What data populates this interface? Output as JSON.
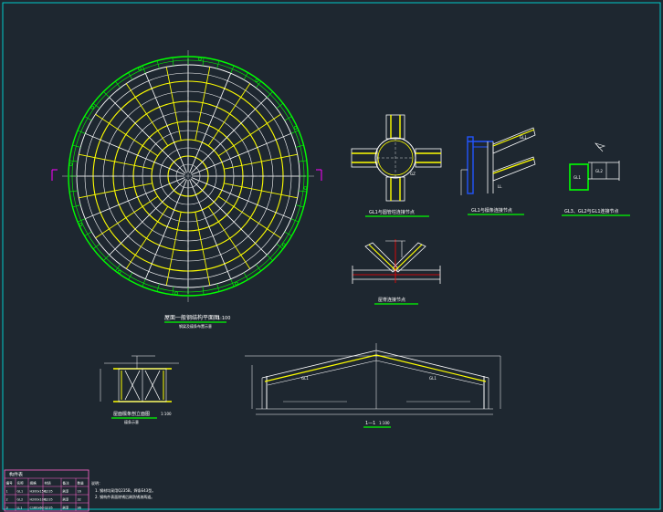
{
  "colors": {
    "background": "#1e2730",
    "frame": "#00c8c8",
    "main_beam": "#ffff00",
    "secondary": "#ffffff",
    "outline": "#00ff00",
    "accent": "#ff0000",
    "column": "#2255ff",
    "marker": "#ff00ff",
    "table": "#ff66cc"
  },
  "plan": {
    "title": "屋面一般钢结构平面图",
    "scale": "1:100",
    "subtitle": "钢梁及檩条布置示意"
  },
  "details": {
    "node1": "GL1与圆管柱连接节点",
    "node2": "GL1与檩条连接节点",
    "node3": "GL3、GL2与GL1连接节点",
    "node4": "屋脊连接节点",
    "truss": "屋面檩条剖立面图",
    "truss_sub": "檩条示意",
    "truss_scale": "1:100",
    "section": "1—1",
    "section_scale": "1:100"
  },
  "tags": {
    "gl1": "GL1",
    "gl2": "GL2",
    "gl3": "GL3",
    "ll": "LL",
    "gz": "GZ",
    "pl": "PL8"
  },
  "table": {
    "title": "构件表",
    "headers": [
      "编号",
      "名称",
      "规格",
      "材质",
      "备注",
      "数量"
    ],
    "rows": [
      [
        "1",
        "GL1",
        "H300x150",
        "Q235",
        "刷漆",
        "16"
      ],
      [
        "2",
        "GL2",
        "H200x100",
        "Q235",
        "刷漆",
        "32"
      ],
      [
        "3",
        "LL1",
        "C160x60",
        "Q235",
        "刷漆",
        "96"
      ]
    ]
  },
  "notes": {
    "heading": "说明：",
    "line1": "1. 钢材均采用Q235B，焊条E43型。",
    "line2": "2. 钢构件表面除锈后刷防锈漆两道。"
  }
}
